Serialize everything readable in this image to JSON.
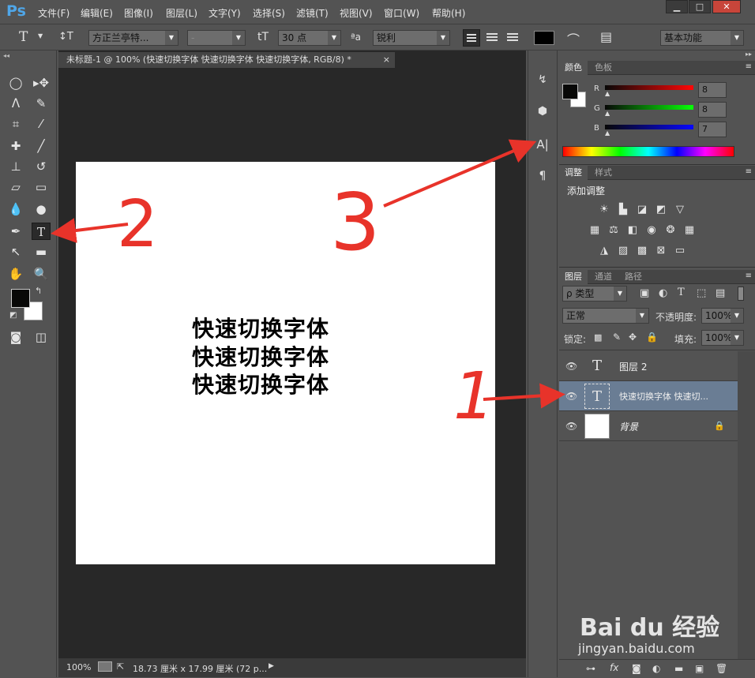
{
  "app": {
    "logo": "Ps"
  },
  "menu": [
    "文件(F)",
    "编辑(E)",
    "图像(I)",
    "图层(L)",
    "文字(Y)",
    "选择(S)",
    "滤镜(T)",
    "视图(V)",
    "窗口(W)",
    "帮助(H)"
  ],
  "window_controls": {
    "minimize": "▁",
    "maximize": "□",
    "close": "✕"
  },
  "options": {
    "tool_icon": "T",
    "orient_icon": "↕T",
    "font_family": "方正兰亭特...",
    "font_style": "-",
    "size_icon": "tT",
    "font_size": "30 点",
    "aa_icon": "ªa",
    "antialias": "锐利",
    "workspace": "基本功能"
  },
  "document": {
    "tab_title": "未标题-1 @ 100% (快速切换字体 快速切换字体 快速切换字体, RGB/8) *",
    "tab_close": "×",
    "lines": [
      "快速切换字体",
      "快速切换字体",
      "快速切换字体"
    ]
  },
  "status": {
    "zoom": "100%",
    "dims": "18.73 厘米 x 17.99 厘米 (72 p...",
    "more": "▶"
  },
  "color_panel": {
    "tabs": [
      "颜色",
      "色板"
    ],
    "r_label": "R",
    "g_label": "G",
    "b_label": "B",
    "r": "8",
    "g": "8",
    "b": "7"
  },
  "adjust_panel": {
    "tabs": [
      "调整",
      "样式"
    ],
    "title": "添加调整"
  },
  "layers_panel": {
    "tabs": [
      "图层",
      "通道",
      "路径"
    ],
    "filter": "ρ 类型",
    "blend_mode": "正常",
    "opacity_label": "不透明度:",
    "opacity": "100%",
    "lock_label": "锁定:",
    "fill_label": "填充:",
    "fill": "100%",
    "layers": [
      {
        "name": "图层 2",
        "thumb": "T"
      },
      {
        "name": "快速切换字体 快速切...",
        "thumb": "T"
      },
      {
        "name": "背景",
        "thumb": ""
      }
    ],
    "footer_icons": [
      "⊶",
      "fx",
      "◙",
      "◐",
      "▬",
      "▣",
      "🗑"
    ]
  },
  "annotations": [
    "1",
    "2",
    "3"
  ],
  "watermark": {
    "brand": "Bai du 经验",
    "url": "jingyan.baidu.com"
  },
  "colors": {
    "accent": "#4fa6e8",
    "annotation_red": "#e8332a",
    "selected_layer": "#6a7d94"
  }
}
